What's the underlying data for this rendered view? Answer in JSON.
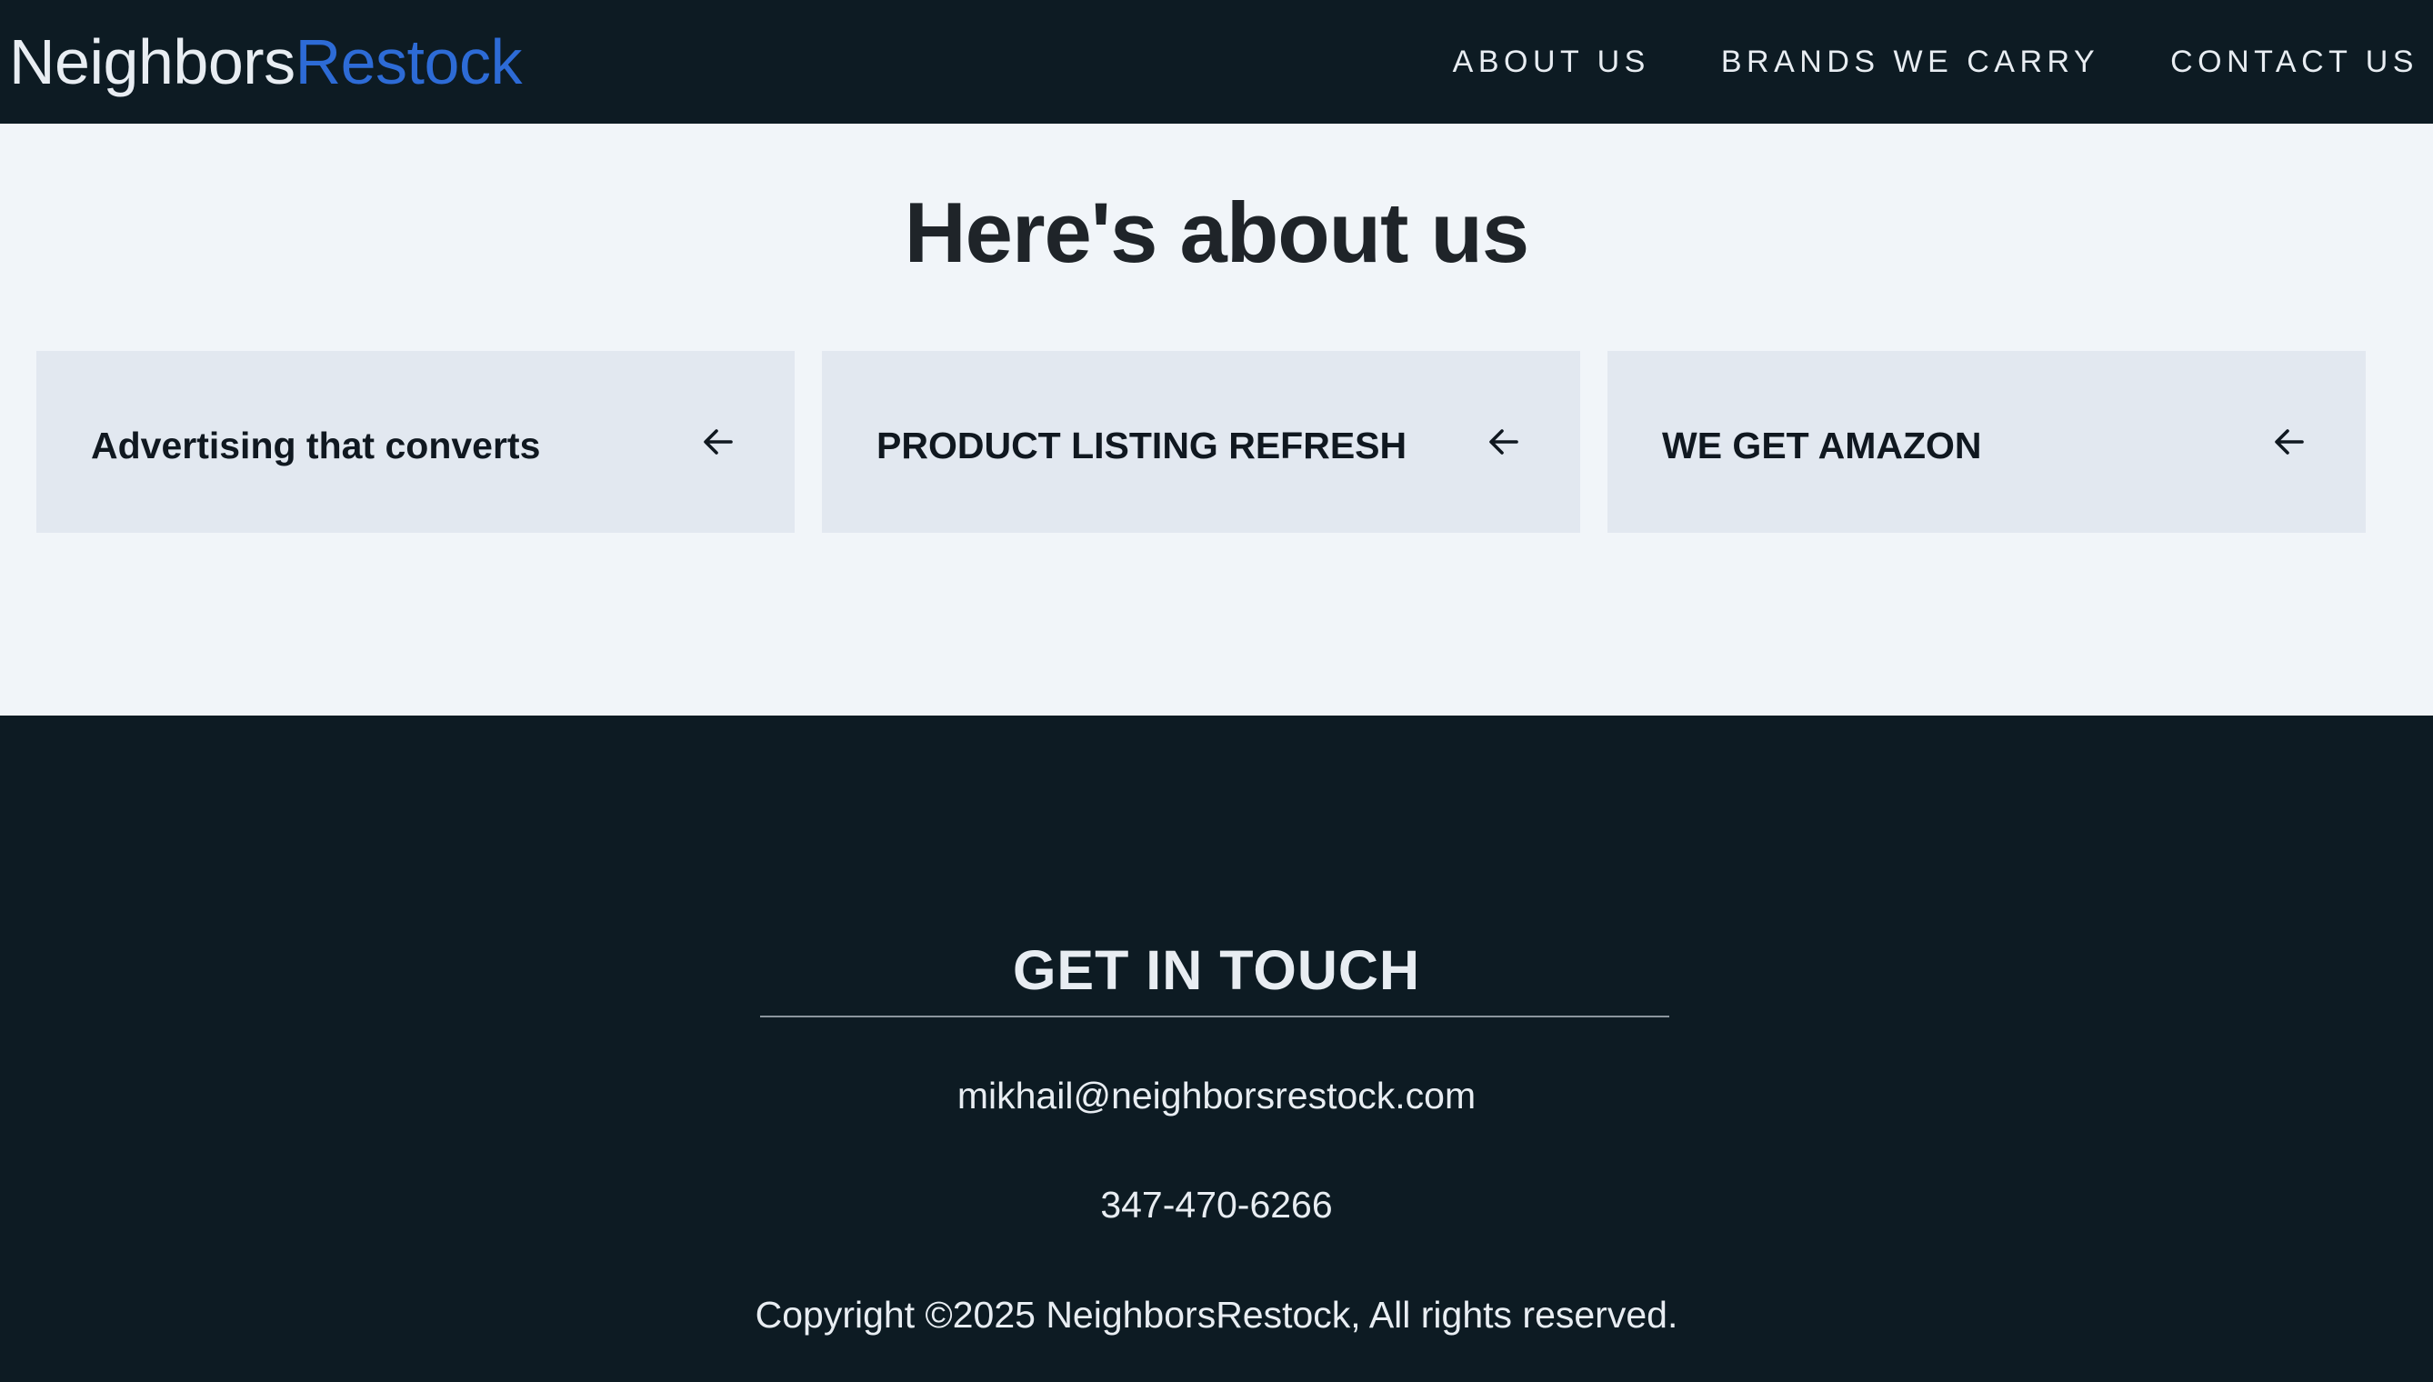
{
  "header": {
    "logo_part_a": "Neighbors",
    "logo_part_b": "Restock",
    "nav": [
      {
        "label": "ABOUT US"
      },
      {
        "label": "BRANDS WE CARRY"
      },
      {
        "label": "CONTACT US"
      }
    ]
  },
  "about": {
    "title": "Here's about us",
    "cards": [
      {
        "label": "Advertising that converts",
        "icon": "arrow-left-icon"
      },
      {
        "label": "PRODUCT LISTING REFRESH",
        "icon": "arrow-left-icon"
      },
      {
        "label": "WE GET AMAZON",
        "icon": "arrow-left-icon"
      }
    ]
  },
  "footer": {
    "title": "GET IN TOUCH",
    "email": "mikhail@neighborsrestock.com",
    "phone": "347-470-6266",
    "copyright": "Copyright ©2025 NeighborsRestock, All rights reserved."
  },
  "colors": {
    "header_bg": "#0d1b23",
    "accent": "#2d6bd6",
    "section_bg": "#f1f5f9",
    "card_bg": "#e2e8f0"
  }
}
